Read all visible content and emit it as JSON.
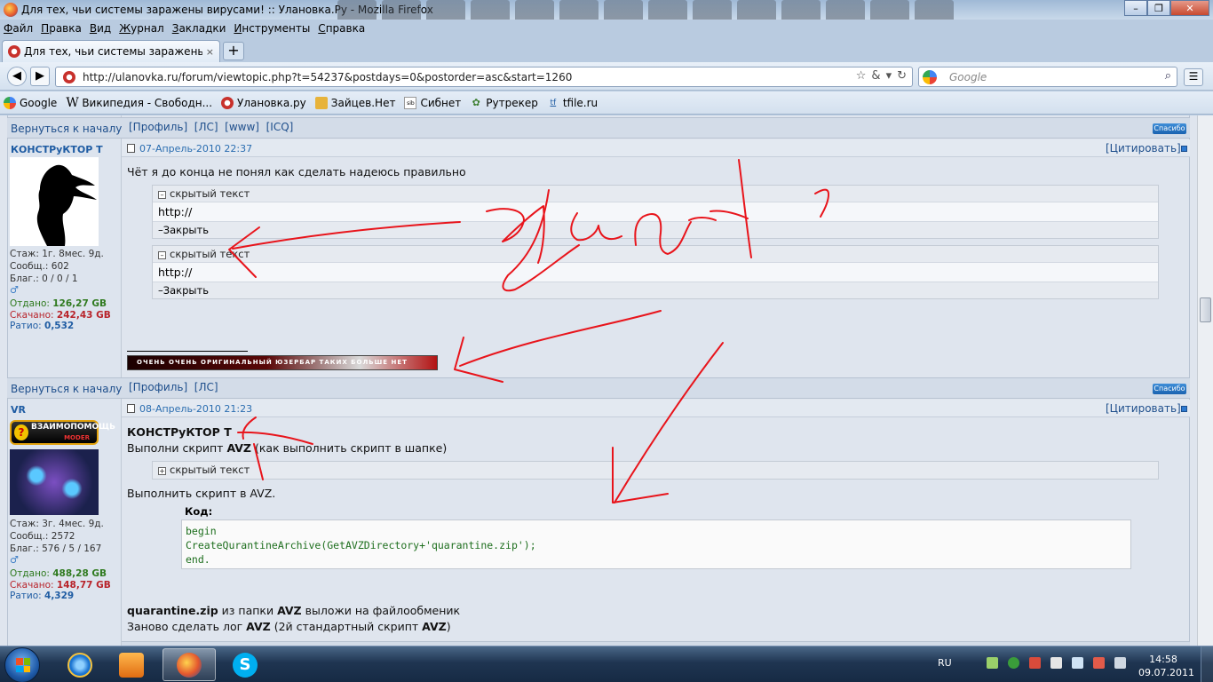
{
  "window": {
    "title": "Для тех, чьи системы заражены вирусами! :: Улановка.Ру - Mozilla Firefox"
  },
  "menu": [
    "Файл",
    "Правка",
    "Вид",
    "Журнал",
    "Закладки",
    "Инструменты",
    "Справка"
  ],
  "tab": {
    "label": "Для тех, чьи системы заражены вирус...",
    "close": "×"
  },
  "newtab": "+",
  "nav": {
    "url": "http://ulanovka.ru/forum/viewtopic.php?t=54237&postdays=0&postorder=asc&start=1260",
    "search_placeholder": "Google",
    "back_icon": "arrow-left-icon",
    "forward_icon": "arrow-right-icon"
  },
  "bookmarks": [
    {
      "label": "Google",
      "icon": "google-icon"
    },
    {
      "label": "Википедия - Свободн...",
      "icon": "wikipedia-icon"
    },
    {
      "label": "Улановка.ру",
      "icon": "ulanovka-icon"
    },
    {
      "label": "Зайцев.Нет",
      "icon": "zaycev-icon"
    },
    {
      "label": "Сибнет",
      "icon": "sibnet-icon"
    },
    {
      "label": "Рутрекер",
      "icon": "rutracker-icon"
    },
    {
      "label": "tfile.ru",
      "icon": "tfile-icon"
    }
  ],
  "forum": {
    "back_to_top": "Вернуться к началу",
    "thanks": "Спасибо",
    "quote": "[Цитировать]",
    "post_bar_1": "[Профиль]  [ЛС]  [www]  [ICQ]",
    "post_bar_2": "[Профиль]  [ЛС]",
    "post1": {
      "author": "КОНСТРуКТОР Т",
      "date": "07-Апрель-2010 22:37",
      "stats": {
        "stazh": "Стаж: 1г. 8мес. 9д.",
        "posts": "Сообщ.: 602",
        "blag": "Благ.: 0 / 0 / 1",
        "otdano_label": "Отдано:",
        "otdano": "126,27 GB",
        "skachano_label": "Скачано:",
        "skachano": "242,43 GB",
        "ratio_label": "Ратио:",
        "ratio": "0,532"
      },
      "text": "Чёт я до конца не понял как сделать надеюсь правильно",
      "spoilers": [
        {
          "head": "скрытый текст",
          "body": "http://",
          "foot": "Закрыть"
        },
        {
          "head": "скрытый текст",
          "body": "http://",
          "foot": "Закрыть"
        }
      ],
      "signature": "ОЧЕНЬ ОЧЕНЬ ОРИГИНАЛЬНЫЙ ЮЗЕРБАР ТАКИХ БОЛЬШЕ НЕТ"
    },
    "post2": {
      "author": "VR",
      "badge_main": "ВЗАИМОПОМОЩЬ",
      "badge_sub": "MODER",
      "date": "08-Апрель-2010 21:23",
      "stats": {
        "stazh": "Стаж: 3г. 4мес. 9д.",
        "posts": "Сообщ.: 2572",
        "blag": "Благ.: 576 / 5 / 167",
        "otdano_label": "Отдано:",
        "otdano": "488,28 GB",
        "skachano_label": "Скачано:",
        "skachano": "148,77 GB",
        "ratio_label": "Ратио:",
        "ratio": "4,329"
      },
      "addressee": "КОНСТРуКТОР Т",
      "line1_a": "Выполни скрипт ",
      "line1_b": "AVZ",
      "line1_c": " (как выполнить скрипт в шапке)",
      "spoiler_head": "скрытый текст",
      "line2": "Выполнить скрипт в AVZ.",
      "code_label": "Код:",
      "code": [
        "begin",
        "CreateQurantineArchive(GetAVZDirectory+'quarantine.zip');",
        "end."
      ],
      "line3_a": "quarantine.zip",
      "line3_b": " из папки ",
      "line3_c": "AVZ",
      "line3_d": " выложи на файлообменик",
      "line4_a": "Заново сделать лог ",
      "line4_b": "AVZ",
      "line4_c": " (2й стандартный скрипт ",
      "line4_d": "AVZ",
      "line4_e": ")"
    }
  },
  "taskbar": {
    "lang": "RU",
    "time": "14:58",
    "date": "09.07.2011"
  },
  "colors": {
    "annotation_red": "#e8141b",
    "link_blue": "#1f4f8c",
    "upload_green": "#2f7a1f",
    "download_red": "#b8232a"
  }
}
